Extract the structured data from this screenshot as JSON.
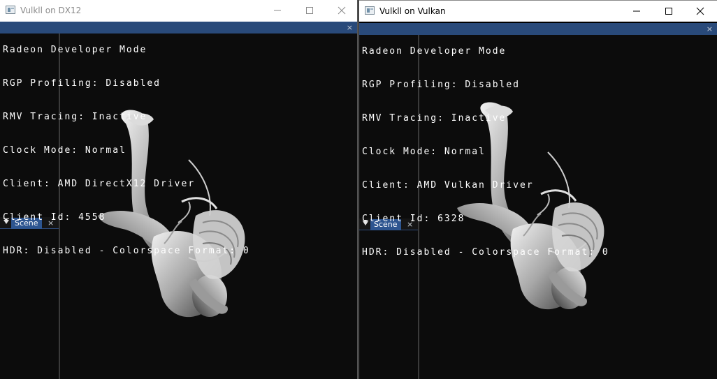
{
  "windows": [
    {
      "title": "Vulkll on DX12",
      "overlay_header": "Radeon Developer Mode",
      "overlay_lines": [
        "RGP Profiling: Disabled",
        "RMV Tracing: Inactive",
        "Clock Mode: Normal",
        "Client: AMD DirectX12 Driver",
        "Client Id: 4558",
        "HDR: Disabled - Colorspace Format: 0"
      ],
      "scene_tab": "Scene",
      "close_glyph": "×"
    },
    {
      "title": "Vulkll on Vulkan",
      "overlay_header": "Radeon Developer Mode",
      "overlay_lines": [
        "RGP Profiling: Disabled",
        "RMV Tracing: Inactive",
        "Clock Mode: Normal",
        "Client: AMD Vulkan Driver",
        "Client Id: 6328",
        "HDR: Disabled - Colorspace Format: 0"
      ],
      "scene_tab": "Scene",
      "close_glyph": "×"
    }
  ],
  "colors": {
    "imgui_title_bar": "#294a7a",
    "scene_tab": "#2d5590",
    "viewport_bg": "#0c0c0c"
  },
  "icons": {
    "app": "app-window-icon",
    "minimize": "minimize-icon",
    "maximize": "maximize-icon",
    "close": "close-icon",
    "collapse": "collapse-triangle-icon"
  }
}
